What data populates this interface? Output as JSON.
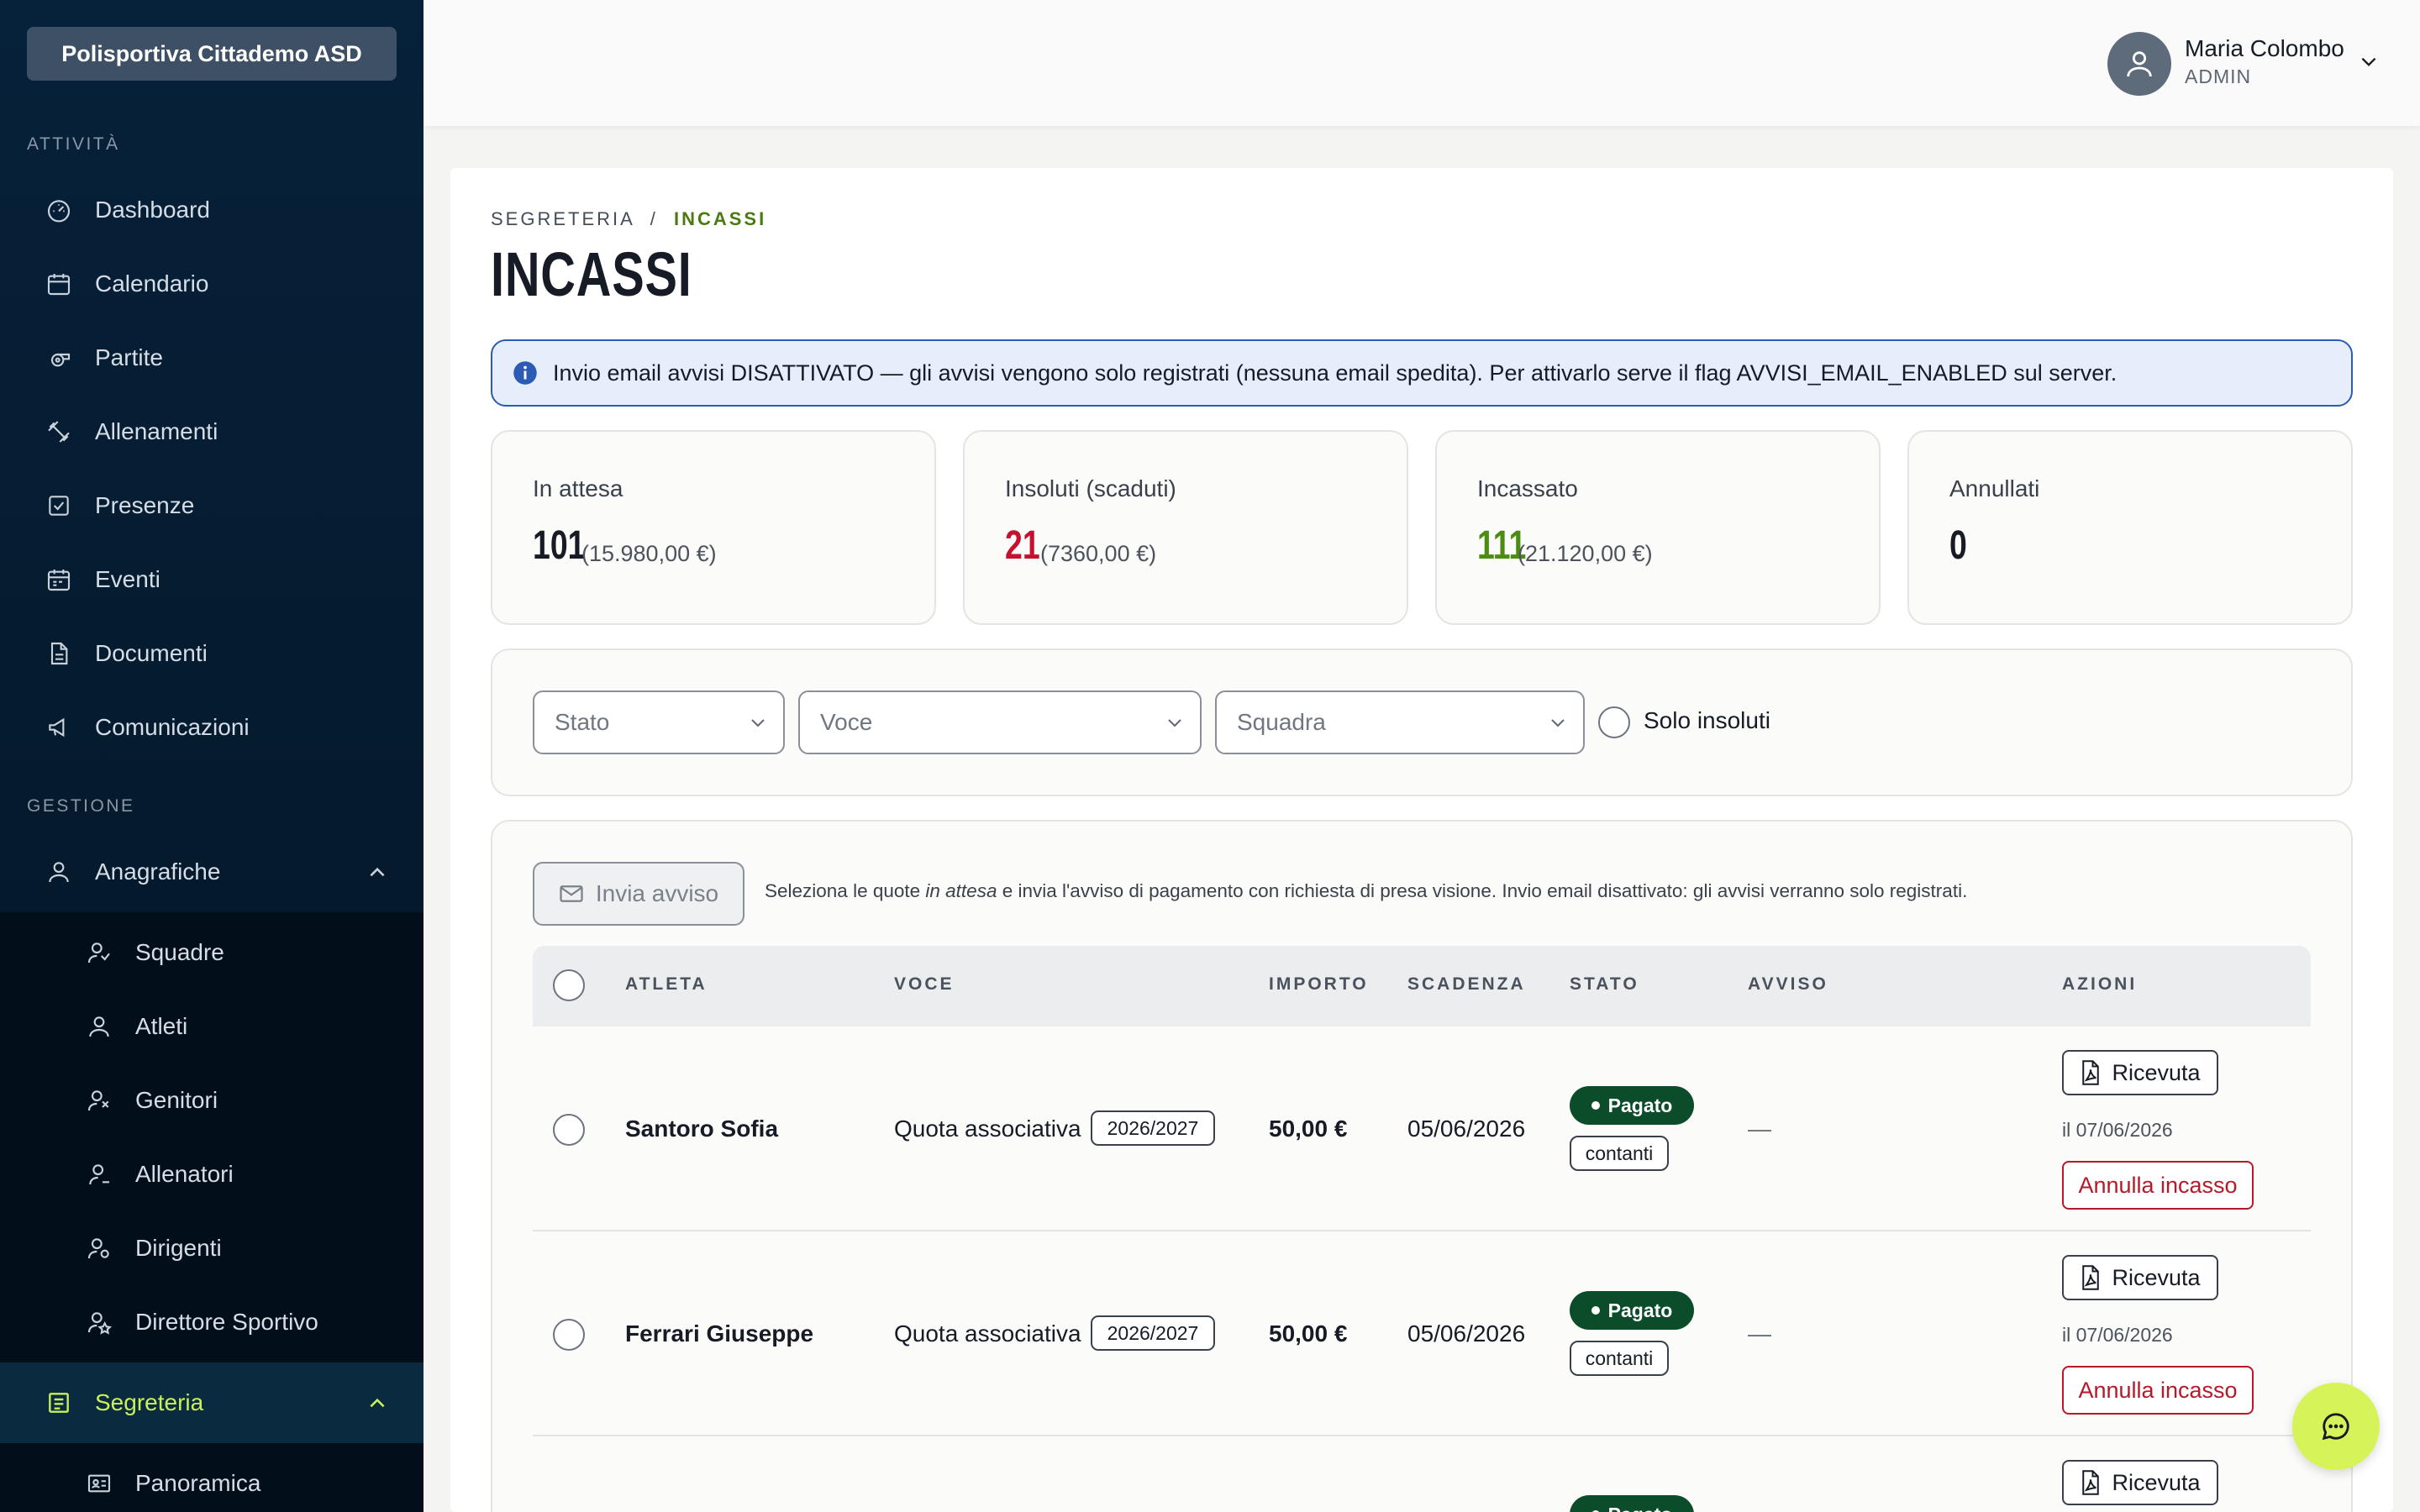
{
  "sidebar": {
    "org_name": "Polisportiva Cittademo ASD",
    "section_attivita": "ATTIVITÀ",
    "section_gestione": "GESTIONE",
    "items": {
      "dashboard": "Dashboard",
      "calendario": "Calendario",
      "partite": "Partite",
      "allenamenti": "Allenamenti",
      "presenze": "Presenze",
      "eventi": "Eventi",
      "documenti": "Documenti",
      "comunicazioni": "Comunicazioni",
      "anagrafiche": "Anagrafiche",
      "squadre": "Squadre",
      "atleti": "Atleti",
      "genitori": "Genitori",
      "allenatori": "Allenatori",
      "dirigenti": "Dirigenti",
      "direttore": "Direttore Sportivo",
      "segreteria": "Segreteria",
      "panoramica": "Panoramica"
    },
    "active_color": "#c8f05a"
  },
  "user": {
    "name": "Maria Colombo",
    "role": "ADMIN"
  },
  "breadcrumb": {
    "parent": "SEGRETERIA",
    "sep": "/",
    "current": "INCASSI"
  },
  "page_title": "INCASSI",
  "info_banner": "Invio email avvisi DISATTIVATO — gli avvisi vengono solo registrati (nessuna email spedita). Per attivarlo serve il flag AVVISI_EMAIL_ENABLED sul server.",
  "cards": {
    "attesa": {
      "title": "In attesa",
      "count": "101",
      "amount": "(15.980,00 €)"
    },
    "insoluti": {
      "title": "Insoluti (scaduti)",
      "count": "21",
      "amount": "(7360,00 €)",
      "color": "#c8102e"
    },
    "incassato": {
      "title": "Incassato",
      "count": "111",
      "amount": "(21.120,00 €)",
      "color": "#4c8c12"
    },
    "annullati": {
      "title": "Annullati",
      "count": "0"
    }
  },
  "filters": {
    "stato": "Stato",
    "voce": "Voce",
    "squadra": "Squadra",
    "solo_insoluti": "Solo insoluti"
  },
  "actions": {
    "invia_avviso": "Invia avviso",
    "hint_pre": "Seleziona le quote ",
    "hint_em": "in attesa",
    "hint_post": " e invia l'avviso di pagamento con richiesta di presa visione. Invio email disattivato: gli avvisi verranno solo registrati."
  },
  "table": {
    "headers": {
      "atleta": "ATLETA",
      "voce": "VOCE",
      "importo": "IMPORTO",
      "scadenza": "SCADENZA",
      "stato": "STATO",
      "avviso": "AVVISO",
      "azioni": "AZIONI"
    },
    "rows": [
      {
        "atleta": "Santoro Sofia",
        "voce": "Quota associativa",
        "anno": "2026/2027",
        "importo": "50,00 €",
        "scadenza": "05/06/2026",
        "stato": "Pagato",
        "metodo": "contanti",
        "avviso": "—",
        "ricevuta": "Ricevuta",
        "data": "il 07/06/2026",
        "annulla": "Annulla incasso"
      },
      {
        "atleta": "Ferrari Giuseppe",
        "voce": "Quota associativa",
        "anno": "2026/2027",
        "importo": "50,00 €",
        "scadenza": "05/06/2026",
        "stato": "Pagato",
        "metodo": "contanti",
        "avviso": "—",
        "ricevuta": "Ricevuta",
        "data": "il 07/06/2026",
        "annulla": "Annulla incasso"
      },
      {
        "stato": "Pagato",
        "ricevuta": "Ricevuta"
      }
    ]
  }
}
